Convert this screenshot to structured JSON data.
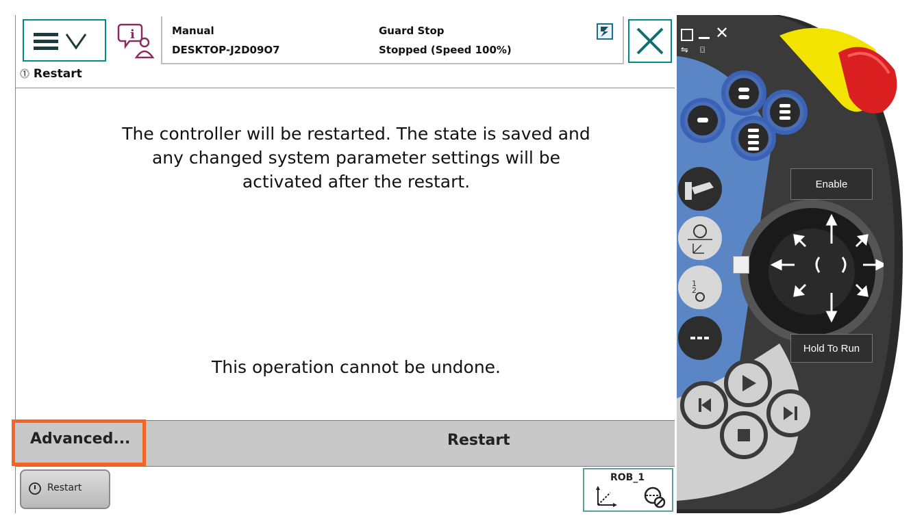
{
  "header": {
    "mode": "Manual",
    "host": "DESKTOP-J2D09O7",
    "safety": "Guard Stop",
    "state": "Stopped (Speed 100%)"
  },
  "breadcrumb": {
    "label": "Restart"
  },
  "dialog": {
    "message": "The controller will be restarted. The state is saved and any changed system parameter settings will be activated after the restart.",
    "warning": "This operation cannot be undone."
  },
  "actions": {
    "advanced_label": "Advanced...",
    "restart_label": "Restart"
  },
  "taskbar": {
    "task_label": "Restart",
    "robot_label": "ROB_1"
  },
  "pendant": {
    "enable_label": "Enable",
    "hold_to_run_label": "Hold To Run"
  },
  "colors": {
    "accent": "#008b8b",
    "highlight": "#f26522",
    "pendant_blue": "#5b86c6",
    "estop_red": "#d91f1f",
    "estop_yellow": "#f2e400"
  }
}
